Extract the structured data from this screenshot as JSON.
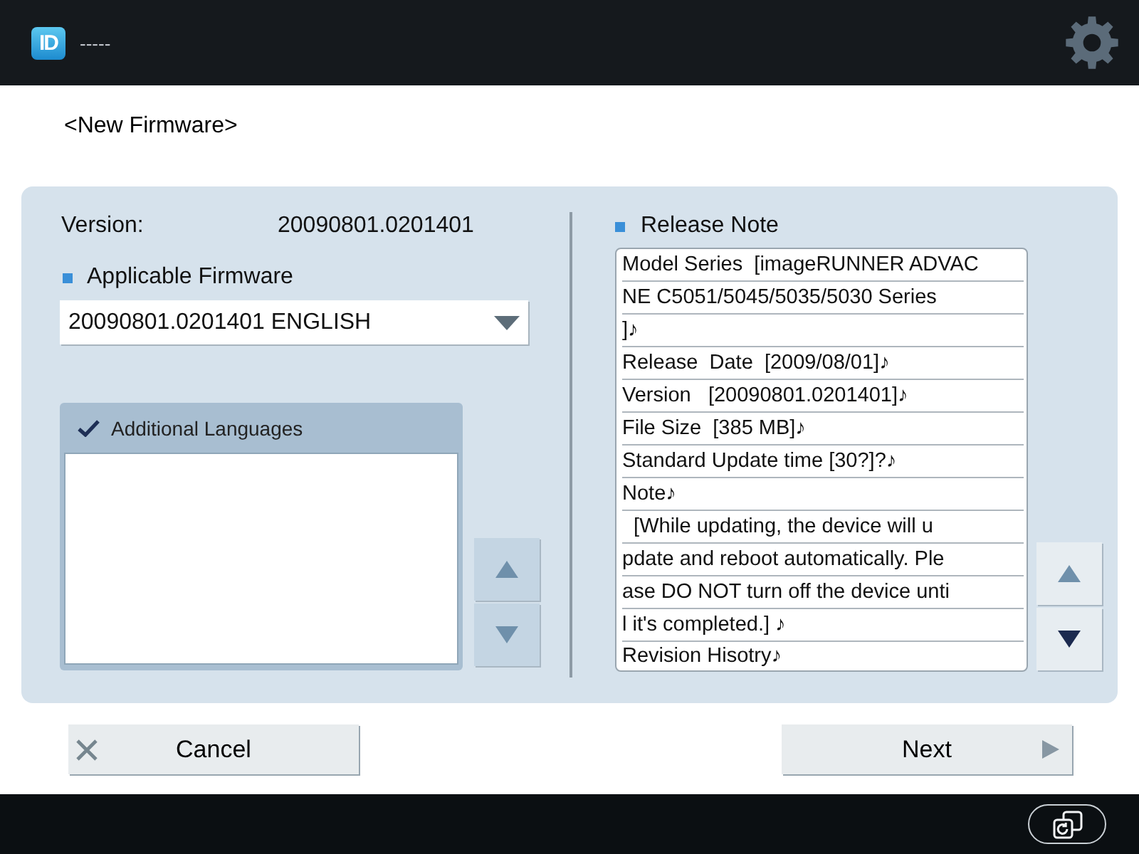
{
  "header": {
    "app_icon": "ID",
    "title": "-----"
  },
  "page_title": "<New Firmware>",
  "version": {
    "label": "Version:",
    "value": "20090801.0201401"
  },
  "applicable_firmware": {
    "label": "Applicable Firmware",
    "value": "20090801.0201401 ENGLISH"
  },
  "additional_languages": {
    "label": "Additional Languages",
    "checked": true,
    "scroll_buttons": [
      {
        "kind": "up",
        "disabled": true
      },
      {
        "kind": "down",
        "disabled": true
      }
    ]
  },
  "release_note": {
    "label": "Release Note",
    "lines": [
      "Model Series  [imageRUNNER ADVAC",
      "NE C5051/5045/5035/5030 Series",
      "]♪",
      "Release  Date  [2009/08/01]♪",
      "Version   [20090801.0201401]♪",
      "File Size  [385 MB]♪",
      "Standard Update time [30?]?♪",
      "Note♪",
      "  [While updating, the device will u",
      "pdate and reboot automatically. Ple",
      "ase DO NOT turn off the device unti",
      "l it's completed.] ♪",
      "Revision Hisotry♪"
    ],
    "scroll_buttons": [
      {
        "kind": "up",
        "disabled": true
      },
      {
        "kind": "down",
        "disabled": false
      }
    ]
  },
  "buttons": [
    {
      "kind": "cancel",
      "label": "Cancel"
    },
    {
      "kind": "next",
      "label": "Next"
    }
  ]
}
